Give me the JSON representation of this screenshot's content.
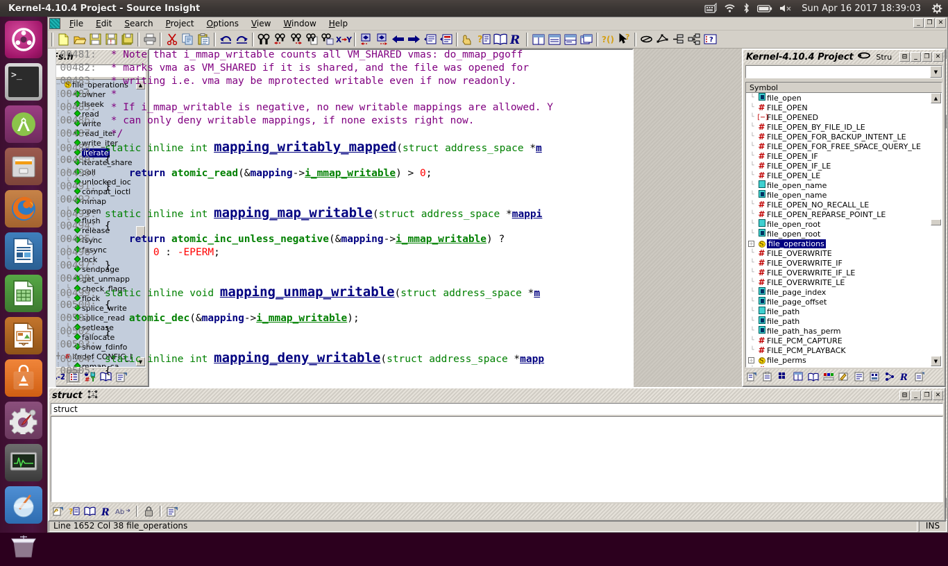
{
  "desktop": {
    "top_panel": {
      "window_title": "Kernel-4.10.4 Project - Source Insight",
      "tray_icons": [
        "keyboard-icon",
        "wifi-icon",
        "bluetooth-icon",
        "battery-icon",
        "volume-muted-icon"
      ],
      "clock": "Sun Apr 16 2017 18:39:03",
      "session_icon": "gear-power-icon"
    },
    "launcher": {
      "items": [
        {
          "name": "ubuntu-dash-icon",
          "label": "Ubuntu Dash"
        },
        {
          "name": "terminal-icon",
          "label": "Terminal"
        },
        {
          "name": "android-studio-icon",
          "label": "Android Studio"
        },
        {
          "name": "files-icon",
          "label": "Files"
        },
        {
          "name": "firefox-icon",
          "label": "Firefox"
        },
        {
          "name": "libreoffice-writer-icon",
          "label": "LibreOffice Writer"
        },
        {
          "name": "libreoffice-calc-icon",
          "label": "LibreOffice Calc"
        },
        {
          "name": "libreoffice-impress-icon",
          "label": "LibreOffice Impress"
        },
        {
          "name": "ubuntu-software-icon",
          "label": "Ubuntu Software"
        },
        {
          "name": "system-settings-icon",
          "label": "System Settings"
        },
        {
          "name": "system-monitor-icon",
          "label": "System Monitor"
        },
        {
          "name": "wine-icon",
          "label": "Wine"
        },
        {
          "name": "trash-icon",
          "label": "Trash"
        }
      ]
    }
  },
  "app": {
    "menu": [
      {
        "label": "File",
        "mnemonic": "F"
      },
      {
        "label": "Edit",
        "mnemonic": "E"
      },
      {
        "label": "Search",
        "mnemonic": "S"
      },
      {
        "label": "Project",
        "mnemonic": "P"
      },
      {
        "label": "Options",
        "mnemonic": "O"
      },
      {
        "label": "View",
        "mnemonic": "V"
      },
      {
        "label": "Window",
        "mnemonic": "W"
      },
      {
        "label": "Help",
        "mnemonic": "H"
      }
    ],
    "window_buttons": [
      "minimize",
      "restore",
      "close"
    ],
    "toolbar_groups": [
      [
        "new-file-icon",
        "open-file-icon",
        "save-icon",
        "save-as-icon",
        "save-all-icon"
      ],
      [
        "print-icon"
      ],
      [
        "cut-icon",
        "copy-icon",
        "paste-icon"
      ],
      [
        "undo-icon",
        "redo-icon"
      ],
      [
        "find-icon",
        "find-previous-icon",
        "find-next-icon",
        "find-in-files-icon",
        "find-references-icon",
        "replace-icon"
      ],
      [
        "shift-left-icon",
        "shift-right-icon",
        "back-icon",
        "forward-icon",
        "jump-to-definition-icon",
        "jump-to-caller-icon"
      ],
      [
        "context-window-icon",
        "symbol-info-icon",
        "browse-project-symbols-icon",
        "relation-window-icon"
      ],
      [
        "tile-horizontal-icon",
        "tile-vertical-icon",
        "split-window-icon",
        "cascade-icon"
      ],
      [
        "parameter-info-icon",
        "smart-rename-icon"
      ],
      [
        "draw-ellipse-icon",
        "draw-polygon-icon",
        "outdent-icon",
        "indent-icon",
        "custom-icon"
      ]
    ]
  },
  "file_panel": {
    "title": "Fs.h",
    "search_value": "",
    "tree": [
      {
        "label": "file_operations",
        "glyph": "struct-icon",
        "depth": 0,
        "selected": false,
        "expander": "collapse"
      },
      {
        "label": "owner",
        "glyph": "member-icon",
        "depth": 1,
        "selected": false
      },
      {
        "label": "llseek",
        "glyph": "member-icon",
        "depth": 1,
        "selected": false
      },
      {
        "label": "read",
        "glyph": "member-icon",
        "depth": 1,
        "selected": false
      },
      {
        "label": "write",
        "glyph": "member-icon",
        "depth": 1,
        "selected": false
      },
      {
        "label": "read_iter",
        "glyph": "member-icon",
        "depth": 1,
        "selected": false
      },
      {
        "label": "write_iter",
        "glyph": "member-icon",
        "depth": 1,
        "selected": false
      },
      {
        "label": "iterate",
        "glyph": "member-icon",
        "depth": 1,
        "selected": true
      },
      {
        "label": "iterate_share",
        "glyph": "member-icon",
        "depth": 1,
        "selected": false
      },
      {
        "label": "poll",
        "glyph": "member-icon",
        "depth": 1,
        "selected": false
      },
      {
        "label": "unlocked_ioc",
        "glyph": "member-icon",
        "depth": 1,
        "selected": false
      },
      {
        "label": "compat_ioctl",
        "glyph": "member-icon",
        "depth": 1,
        "selected": false
      },
      {
        "label": "mmap",
        "glyph": "member-icon",
        "depth": 1,
        "selected": false
      },
      {
        "label": "open",
        "glyph": "member-icon",
        "depth": 1,
        "selected": false
      },
      {
        "label": "flush",
        "glyph": "member-icon",
        "depth": 1,
        "selected": false
      },
      {
        "label": "release",
        "glyph": "member-icon",
        "depth": 1,
        "selected": false
      },
      {
        "label": "fsync",
        "glyph": "member-icon",
        "depth": 1,
        "selected": false
      },
      {
        "label": "fasync",
        "glyph": "member-icon",
        "depth": 1,
        "selected": false
      },
      {
        "label": "lock",
        "glyph": "member-icon",
        "depth": 1,
        "selected": false
      },
      {
        "label": "sendpage",
        "glyph": "member-icon",
        "depth": 1,
        "selected": false
      },
      {
        "label": "get_unmapp",
        "glyph": "member-icon",
        "depth": 1,
        "selected": false
      },
      {
        "label": "check_flags",
        "glyph": "member-icon",
        "depth": 1,
        "selected": false
      },
      {
        "label": "flock",
        "glyph": "member-icon",
        "depth": 1,
        "selected": false
      },
      {
        "label": "splice_write",
        "glyph": "member-icon",
        "depth": 1,
        "selected": false
      },
      {
        "label": "splice_read",
        "glyph": "member-icon",
        "depth": 1,
        "selected": false
      },
      {
        "label": "setlease",
        "glyph": "member-icon",
        "depth": 1,
        "selected": false
      },
      {
        "label": "fallocate",
        "glyph": "member-icon",
        "depth": 1,
        "selected": false
      },
      {
        "label": "show_fdinfo",
        "glyph": "member-icon",
        "depth": 1,
        "selected": false
      },
      {
        "label": "ifndef CONFIG_I",
        "glyph": "macro-icon",
        "depth": 0,
        "selected": false,
        "expander": "expand"
      },
      {
        "label": "mmap_ca",
        "glyph": "member-icon",
        "depth": 1,
        "selected": false
      }
    ],
    "tools": [
      "sort-az-icon",
      "outline-icon",
      "symbol-type-icon",
      "book-icon",
      "properties-icon"
    ]
  },
  "editor": {
    "first_line": 481,
    "lines": [
      {
        "num": "00481:",
        "tokens": [
          {
            "t": " * Note that i_mmap_writable counts all VM_SHARED vmas: do_mmap_pgoff",
            "c": "cmt"
          }
        ]
      },
      {
        "num": "00482:",
        "tokens": [
          {
            "t": " * marks vma as VM_SHARED if it is shared, and the file was opened for",
            "c": "cmt"
          }
        ]
      },
      {
        "num": "00483:",
        "tokens": [
          {
            "t": " * writing i.e. vma may be mprotected writable even if now readonly.",
            "c": "cmt"
          }
        ]
      },
      {
        "num": "00484:",
        "tokens": [
          {
            "t": " *",
            "c": "cmt"
          }
        ]
      },
      {
        "num": "00485:",
        "tokens": [
          {
            "t": " * If i_mmap_writable is negative, no new writable mappings are allowed. Y",
            "c": "cmt"
          }
        ]
      },
      {
        "num": "00486:",
        "tokens": [
          {
            "t": " * can only deny writable mappings, if none exists right now.",
            "c": "cmt"
          }
        ]
      },
      {
        "num": "00487:",
        "tokens": [
          {
            "t": " */",
            "c": "cmt"
          }
        ]
      },
      {
        "num": "00488:",
        "tokens": [
          {
            "t": "static inline int ",
            "c": "kw"
          },
          {
            "t": "mapping_writably_mapped",
            "c": "fn"
          },
          {
            "t": "(",
            "c": "pl"
          },
          {
            "t": "struct ",
            "c": "kw"
          },
          {
            "t": "address_space ",
            "c": "kw"
          },
          {
            "t": "*",
            "c": "pl"
          },
          {
            "t": "m",
            "c": "idu"
          }
        ]
      },
      {
        "num": "00489:",
        "tokens": [
          {
            "t": "{",
            "c": "pl"
          }
        ]
      },
      {
        "num": "00490:",
        "tokens": [
          {
            "t": "    ",
            "c": "pl"
          },
          {
            "t": "return ",
            "c": "id"
          },
          {
            "t": "atomic_read",
            "c": "kw2"
          },
          {
            "t": "(&",
            "c": "pl"
          },
          {
            "t": "mapping",
            "c": "id"
          },
          {
            "t": "->",
            "c": "pl"
          },
          {
            "t": "i_mmap_writable",
            "c": "idu2"
          },
          {
            "t": ") > ",
            "c": "pl"
          },
          {
            "t": "0",
            "c": "num"
          },
          {
            "t": ";",
            "c": "pl"
          }
        ]
      },
      {
        "num": "00491:",
        "tokens": [
          {
            "t": "}",
            "c": "pl"
          }
        ]
      },
      {
        "num": "00492:",
        "tokens": []
      },
      {
        "num": "00493:",
        "tokens": [
          {
            "t": "static inline int ",
            "c": "kw"
          },
          {
            "t": "mapping_map_writable",
            "c": "fn"
          },
          {
            "t": "(",
            "c": "pl"
          },
          {
            "t": "struct ",
            "c": "kw"
          },
          {
            "t": "address_space ",
            "c": "kw"
          },
          {
            "t": "*",
            "c": "pl"
          },
          {
            "t": "mappi",
            "c": "idu"
          }
        ]
      },
      {
        "num": "00494:",
        "tokens": [
          {
            "t": "{",
            "c": "pl"
          }
        ]
      },
      {
        "num": "00495:",
        "tokens": [
          {
            "t": "    ",
            "c": "pl"
          },
          {
            "t": "return ",
            "c": "id"
          },
          {
            "t": "atomic_inc_unless_negative",
            "c": "kw2"
          },
          {
            "t": "(&",
            "c": "pl"
          },
          {
            "t": "mapping",
            "c": "id"
          },
          {
            "t": "->",
            "c": "pl"
          },
          {
            "t": "i_mmap_writable",
            "c": "idu2"
          },
          {
            "t": ") ?",
            "c": "pl"
          }
        ]
      },
      {
        "num": "00496:",
        "tokens": [
          {
            "t": "        ",
            "c": "pl"
          },
          {
            "t": "0",
            "c": "num"
          },
          {
            "t": " : ",
            "c": "pl"
          },
          {
            "t": "-EPERM",
            "c": "num"
          },
          {
            "t": ";",
            "c": "pl"
          }
        ]
      },
      {
        "num": "00497:",
        "tokens": [
          {
            "t": "}",
            "c": "pl"
          }
        ]
      },
      {
        "num": "00498:",
        "tokens": []
      },
      {
        "num": "00499:",
        "tokens": [
          {
            "t": "static inline void ",
            "c": "kw"
          },
          {
            "t": "mapping_unmap_writable",
            "c": "fn"
          },
          {
            "t": "(",
            "c": "pl"
          },
          {
            "t": "struct ",
            "c": "kw"
          },
          {
            "t": "address_space ",
            "c": "kw"
          },
          {
            "t": "*",
            "c": "pl"
          },
          {
            "t": "m",
            "c": "idu"
          }
        ]
      },
      {
        "num": "00500:",
        "tokens": [
          {
            "t": "{",
            "c": "pl"
          }
        ]
      },
      {
        "num": "00501:",
        "tokens": [
          {
            "t": "    ",
            "c": "pl"
          },
          {
            "t": "atomic_dec",
            "c": "kw2"
          },
          {
            "t": "(&",
            "c": "pl"
          },
          {
            "t": "mapping",
            "c": "id"
          },
          {
            "t": "->",
            "c": "pl"
          },
          {
            "t": "i_mmap_writable",
            "c": "idu2"
          },
          {
            "t": ");",
            "c": "pl"
          }
        ]
      },
      {
        "num": "00502:",
        "tokens": [
          {
            "t": "}",
            "c": "pl"
          }
        ]
      },
      {
        "num": "00503:",
        "tokens": []
      },
      {
        "num": "00504:",
        "tokens": [
          {
            "t": "static inline int ",
            "c": "kw"
          },
          {
            "t": "mapping_deny_writable",
            "c": "fn"
          },
          {
            "t": "(",
            "c": "pl"
          },
          {
            "t": "struct ",
            "c": "kw"
          },
          {
            "t": "address_space ",
            "c": "kw"
          },
          {
            "t": "*",
            "c": "pl"
          },
          {
            "t": "mapp",
            "c": "idu"
          }
        ]
      },
      {
        "num": "00505:",
        "tokens": [
          {
            "t": "{",
            "c": "pl"
          }
        ]
      }
    ]
  },
  "symbol_panel": {
    "title": "Kernel-4.10.4 Project",
    "title_suffix_icon": "link-icon",
    "tab_label": "Stru",
    "combo_value": "",
    "list_header": "Symbol",
    "items": [
      {
        "label": "file_open",
        "glyph": "function-icon",
        "selected": false
      },
      {
        "label": "FILE_OPEN",
        "glyph": "macro-hash-icon",
        "selected": false
      },
      {
        "label": "FILE_OPENED",
        "glyph": "macro-bracket-icon",
        "selected": false
      },
      {
        "label": "FILE_OPEN_BY_FILE_ID_LE",
        "glyph": "macro-hash-icon",
        "selected": false
      },
      {
        "label": "FILE_OPEN_FOR_BACKUP_INTENT_LE",
        "glyph": "macro-hash-icon",
        "selected": false
      },
      {
        "label": "FILE_OPEN_FOR_FREE_SPACE_QUERY_LE",
        "glyph": "macro-hash-icon",
        "selected": false
      },
      {
        "label": "FILE_OPEN_IF",
        "glyph": "macro-hash-icon",
        "selected": false
      },
      {
        "label": "FILE_OPEN_IF_LE",
        "glyph": "macro-hash-icon",
        "selected": false
      },
      {
        "label": "FILE_OPEN_LE",
        "glyph": "macro-hash-icon",
        "selected": false
      },
      {
        "label": "file_open_name",
        "glyph": "declaration-icon",
        "selected": false
      },
      {
        "label": "file_open_name",
        "glyph": "function-icon",
        "selected": false
      },
      {
        "label": "FILE_OPEN_NO_RECALL_LE",
        "glyph": "macro-hash-icon",
        "selected": false
      },
      {
        "label": "FILE_OPEN_REPARSE_POINT_LE",
        "glyph": "macro-hash-icon",
        "selected": false
      },
      {
        "label": "file_open_root",
        "glyph": "declaration-icon",
        "selected": false
      },
      {
        "label": "file_open_root",
        "glyph": "function-icon",
        "selected": false
      },
      {
        "label": "file_operations",
        "glyph": "struct-icon",
        "selected": true,
        "expander": "expand"
      },
      {
        "label": "FILE_OVERWRITE",
        "glyph": "macro-hash-icon",
        "selected": false
      },
      {
        "label": "FILE_OVERWRITE_IF",
        "glyph": "macro-hash-icon",
        "selected": false
      },
      {
        "label": "FILE_OVERWRITE_IF_LE",
        "glyph": "macro-hash-icon",
        "selected": false
      },
      {
        "label": "FILE_OVERWRITE_LE",
        "glyph": "macro-hash-icon",
        "selected": false
      },
      {
        "label": "file_page_index",
        "glyph": "function-icon",
        "selected": false
      },
      {
        "label": "file_page_offset",
        "glyph": "function-icon",
        "selected": false
      },
      {
        "label": "file_path",
        "glyph": "declaration-icon",
        "selected": false
      },
      {
        "label": "file_path",
        "glyph": "function-icon",
        "selected": false
      },
      {
        "label": "file_path_has_perm",
        "glyph": "function-icon",
        "selected": false
      },
      {
        "label": "FILE_PCM_CAPTURE",
        "glyph": "macro-hash-icon",
        "selected": false
      },
      {
        "label": "FILE_PCM_PLAYBACK",
        "glyph": "macro-hash-icon",
        "selected": false
      },
      {
        "label": "file_perms",
        "glyph": "struct-icon",
        "selected": false,
        "expander": "expand"
      },
      {
        "label": "FILE_PERSISTENT_ACLS",
        "glyph": "macro-hash-icon",
        "selected": false
      }
    ],
    "tools": [
      "context-icon",
      "clipboard-icon",
      "grid-icon",
      "tile-icon",
      "book-icon",
      "symbol-colors-icon",
      "annotate-icon",
      "outline-a-icon",
      "outline-b-icon",
      "relation-icon",
      "reference-icon",
      "new-window-icon"
    ]
  },
  "struct_panel": {
    "title": "struct",
    "title_icon": "relation-window-icon",
    "input_value": "struct",
    "body_text": "",
    "tools": [
      "context-icon",
      "copy-icon",
      "book-icon",
      "relation-icon",
      "abbrev-icon",
      "lock-icon",
      "properties-icon"
    ]
  },
  "status_bar": {
    "message": "Line 1652 Col 38   file_operations",
    "mode": "INS"
  }
}
